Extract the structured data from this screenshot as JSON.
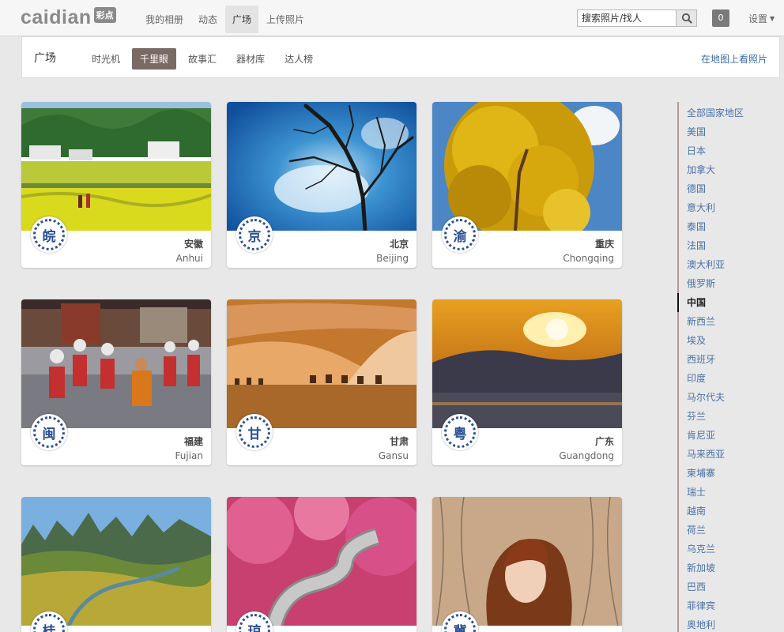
{
  "header": {
    "logo_text": "caidian",
    "logo_badge": "彩点",
    "nav": [
      {
        "label": "我的相册",
        "active": false
      },
      {
        "label": "动态",
        "active": false
      },
      {
        "label": "广场",
        "active": true
      },
      {
        "label": "上传照片",
        "active": false
      }
    ],
    "search_placeholder": "搜索照片/找人",
    "notification_count": "0",
    "settings_label": "设置"
  },
  "subbar": {
    "title": "广场",
    "tabs": [
      {
        "label": "时光机",
        "active": false
      },
      {
        "label": "千里眼",
        "active": true
      },
      {
        "label": "故事汇",
        "active": false
      },
      {
        "label": "器材库",
        "active": false
      },
      {
        "label": "达人榜",
        "active": false
      }
    ],
    "map_link": "在地图上看照片"
  },
  "cards": [
    {
      "seal": "皖",
      "cn": "安徽",
      "en": "Anhui",
      "scene": "fields"
    },
    {
      "seal": "京",
      "cn": "北京",
      "en": "Beijing",
      "scene": "tree"
    },
    {
      "seal": "渝",
      "cn": "重庆",
      "en": "Chongqing",
      "scene": "ginkgo"
    },
    {
      "seal": "闽",
      "cn": "福建",
      "en": "Fujian",
      "scene": "dancers"
    },
    {
      "seal": "甘",
      "cn": "甘肃",
      "en": "Gansu",
      "scene": "desert"
    },
    {
      "seal": "粤",
      "cn": "广东",
      "en": "Guangdong",
      "scene": "sunset"
    },
    {
      "seal": "桂",
      "cn": "",
      "en": "",
      "scene": "karst"
    },
    {
      "seal": "琼",
      "cn": "",
      "en": "",
      "scene": "pink"
    },
    {
      "seal": "冀",
      "cn": "",
      "en": "",
      "scene": "portrait"
    }
  ],
  "sidebar": {
    "countries": [
      {
        "label": "全部国家地区",
        "active": false
      },
      {
        "label": "美国",
        "active": false
      },
      {
        "label": "日本",
        "active": false
      },
      {
        "label": "加拿大",
        "active": false
      },
      {
        "label": "德国",
        "active": false
      },
      {
        "label": "意大利",
        "active": false
      },
      {
        "label": "泰国",
        "active": false
      },
      {
        "label": "法国",
        "active": false
      },
      {
        "label": "澳大利亚",
        "active": false
      },
      {
        "label": "俄罗斯",
        "active": false
      },
      {
        "label": "中国",
        "active": true
      },
      {
        "label": "新西兰",
        "active": false
      },
      {
        "label": "埃及",
        "active": false
      },
      {
        "label": "西班牙",
        "active": false
      },
      {
        "label": "印度",
        "active": false
      },
      {
        "label": "马尔代夫",
        "active": false
      },
      {
        "label": "芬兰",
        "active": false
      },
      {
        "label": "肯尼亚",
        "active": false
      },
      {
        "label": "马来西亚",
        "active": false
      },
      {
        "label": "柬埔寨",
        "active": false
      },
      {
        "label": "瑞士",
        "active": false
      },
      {
        "label": "越南",
        "active": false
      },
      {
        "label": "荷兰",
        "active": false
      },
      {
        "label": "乌克兰",
        "active": false
      },
      {
        "label": "新加坡",
        "active": false
      },
      {
        "label": "巴西",
        "active": false
      },
      {
        "label": "菲律宾",
        "active": false
      },
      {
        "label": "奥地利",
        "active": false
      }
    ]
  }
}
